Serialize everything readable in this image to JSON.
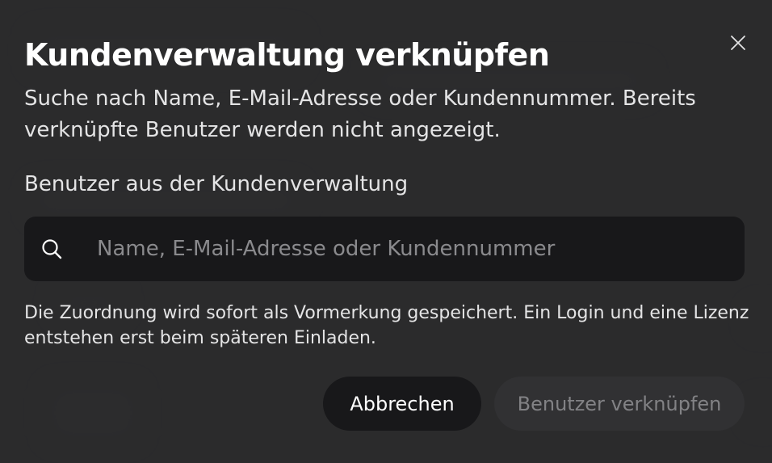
{
  "dialog": {
    "title": "Kundenverwaltung verknüpfen",
    "subtitle": "Suche nach Name, E-Mail-Adresse oder Kundennummer. Bereits verknüpfte Benutzer werden nicht angezeigt.",
    "field_label": "Benutzer aus der Kundenverwaltung",
    "search": {
      "placeholder": "Name, E-Mail-Adresse oder Kundennummer",
      "value": ""
    },
    "hint": "Die Zuordnung wird sofort als Vormerkung gespeichert. Ein Login und eine Lizenz entstehen erst beim späteren Einladen.",
    "buttons": {
      "cancel": "Abbrechen",
      "link": "Benutzer verknüpfen"
    },
    "icons": {
      "close": "close-icon",
      "search": "search-icon"
    }
  },
  "colors": {
    "overlay": "#2b2b2c",
    "input_background": "#18181a",
    "cancel_background": "#18181a",
    "disabled_button_background": "#313133",
    "disabled_button_text": "#828285",
    "text_primary": "#ffffff",
    "text_secondary": "#e4e4e5",
    "placeholder": "#8a8a8d"
  }
}
